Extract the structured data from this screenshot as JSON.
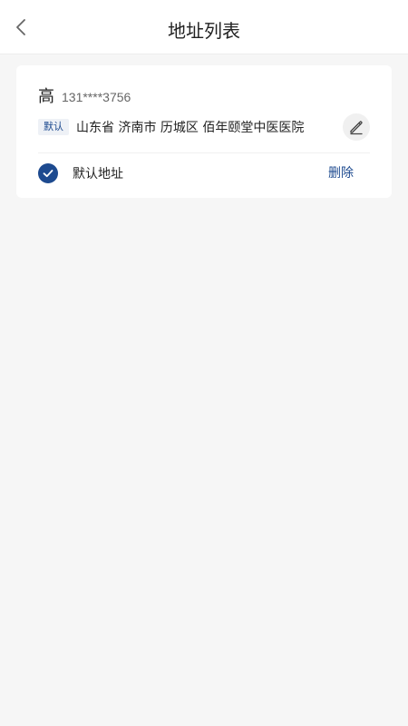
{
  "header": {
    "title": "地址列表",
    "back_icon": "chevron-left-icon"
  },
  "address_list": [
    {
      "name": "高",
      "phone": "131****3756",
      "default_tag": "默认",
      "address": "山东省 济南市 历城区 佰年颐堂中医医院",
      "edit_icon": "pencil-icon",
      "is_default": true,
      "default_label": "默认地址",
      "delete_label": "删除"
    }
  ],
  "colors": {
    "accent": "#1d4a8f",
    "background": "#f6f6f6",
    "card": "#ffffff"
  }
}
